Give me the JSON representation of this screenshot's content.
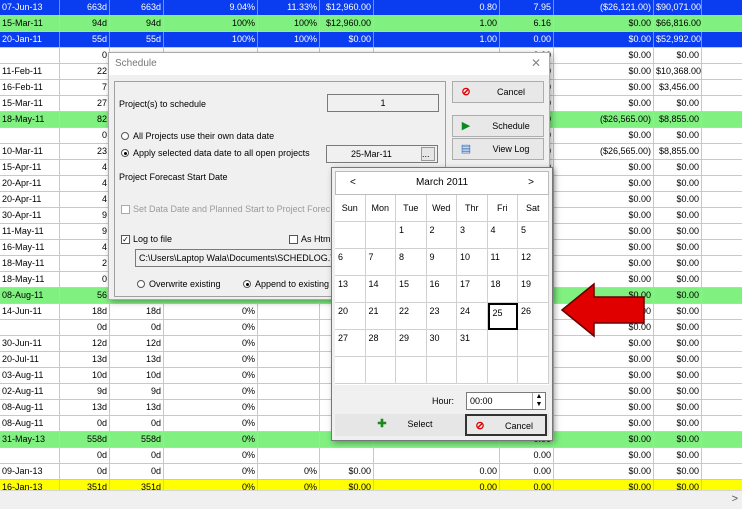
{
  "grid_rows": [
    {
      "style": "blue",
      "c": [
        "07-Jun-13",
        "663d",
        "663d",
        "9.04%",
        "11.33%",
        "$12,960.00",
        "0.80",
        "7.95",
        "($26,121.00)",
        "$90,071.00"
      ]
    },
    {
      "style": "green",
      "c": [
        "15-Mar-11",
        "94d",
        "94d",
        "100%",
        "100%",
        "$12,960.00",
        "1.00",
        "6.16",
        "$0.00",
        "$66,816.00"
      ]
    },
    {
      "style": "blue",
      "c": [
        "20-Jan-11",
        "55d",
        "55d",
        "100%",
        "100%",
        "$0.00",
        "1.00",
        "0.00",
        "$0.00",
        "$52,992.00"
      ]
    },
    {
      "style": "",
      "c": [
        "",
        "0",
        "",
        "",
        "",
        "",
        "",
        "0.00",
        "$0.00",
        "$0.00"
      ]
    },
    {
      "style": "",
      "c": [
        "11-Feb-11",
        "22",
        "",
        "",
        "",
        "",
        "",
        "0.00",
        "$0.00",
        "$10,368.00"
      ]
    },
    {
      "style": "",
      "c": [
        "16-Feb-11",
        "7",
        "",
        "",
        "",
        "",
        "",
        "0.00",
        "$0.00",
        "$3,456.00"
      ]
    },
    {
      "style": "",
      "c": [
        "15-Mar-11",
        "27",
        "",
        "",
        "",
        "",
        "",
        "1.00",
        "$0.00",
        "$0.00"
      ]
    },
    {
      "style": "green",
      "c": [
        "18-May-11",
        "82",
        "",
        "",
        "",
        "",
        "",
        "0.00",
        "($26,565.00)",
        "$8,855.00"
      ]
    },
    {
      "style": "",
      "c": [
        "",
        "0",
        "",
        "",
        "",
        "",
        "",
        "0.00",
        "$0.00",
        "$0.00"
      ]
    },
    {
      "style": "",
      "c": [
        "10-Mar-11",
        "23",
        "",
        "",
        "",
        "",
        "",
        "0.00",
        "($26,565.00)",
        "$8,855.00"
      ]
    },
    {
      "style": "",
      "c": [
        "15-Apr-11",
        "4",
        "",
        "",
        "",
        "",
        "",
        "0.00",
        "$0.00",
        "$0.00"
      ]
    },
    {
      "style": "",
      "c": [
        "20-Apr-11",
        "4",
        "",
        "",
        "",
        "",
        "",
        "0.00",
        "$0.00",
        "$0.00"
      ]
    },
    {
      "style": "",
      "c": [
        "20-Apr-11",
        "4",
        "",
        "",
        "",
        "",
        "",
        "0.00",
        "$0.00",
        "$0.00"
      ]
    },
    {
      "style": "",
      "c": [
        "30-Apr-11",
        "9",
        "",
        "",
        "",
        "",
        "",
        "0.00",
        "$0.00",
        "$0.00"
      ]
    },
    {
      "style": "",
      "c": [
        "11-May-11",
        "9",
        "",
        "",
        "",
        "",
        "",
        "0.00",
        "$0.00",
        "$0.00"
      ]
    },
    {
      "style": "",
      "c": [
        "16-May-11",
        "4",
        "",
        "",
        "",
        "",
        "",
        "0.00",
        "$0.00",
        "$0.00"
      ]
    },
    {
      "style": "",
      "c": [
        "18-May-11",
        "2",
        "",
        "",
        "",
        "",
        "",
        "0.00",
        "$0.00",
        "$0.00"
      ]
    },
    {
      "style": "",
      "c": [
        "18-May-11",
        "0",
        "",
        "",
        "",
        "",
        "",
        "0.00",
        "$0.00",
        "$0.00"
      ]
    },
    {
      "style": "green",
      "c": [
        "08-Aug-11",
        "56",
        "",
        "",
        "",
        "",
        "",
        "0.00",
        "$0.00",
        "$0.00"
      ]
    },
    {
      "style": "",
      "c": [
        "14-Jun-11",
        "18d",
        "18d",
        "0%",
        "",
        "",
        "",
        "0.00",
        "$0.00",
        "$0.00"
      ]
    },
    {
      "style": "",
      "c": [
        "",
        "0d",
        "0d",
        "0%",
        "",
        "",
        "",
        "0.00",
        "$0.00",
        "$0.00"
      ]
    },
    {
      "style": "",
      "c": [
        "30-Jun-11",
        "12d",
        "12d",
        "0%",
        "",
        "",
        "",
        "0.00",
        "$0.00",
        "$0.00"
      ]
    },
    {
      "style": "",
      "c": [
        "20-Jul-11",
        "13d",
        "13d",
        "0%",
        "",
        "",
        "",
        "0.00",
        "$0.00",
        "$0.00"
      ]
    },
    {
      "style": "",
      "c": [
        "03-Aug-11",
        "10d",
        "10d",
        "0%",
        "",
        "",
        "",
        "0.00",
        "$0.00",
        "$0.00"
      ]
    },
    {
      "style": "",
      "c": [
        "02-Aug-11",
        "9d",
        "9d",
        "0%",
        "",
        "",
        "",
        "0.00",
        "$0.00",
        "$0.00"
      ]
    },
    {
      "style": "",
      "c": [
        "08-Aug-11",
        "13d",
        "13d",
        "0%",
        "",
        "",
        "",
        "0.00",
        "$0.00",
        "$0.00"
      ]
    },
    {
      "style": "",
      "c": [
        "08-Aug-11",
        "0d",
        "0d",
        "0%",
        "",
        "",
        "",
        "0.00",
        "$0.00",
        "$0.00"
      ]
    },
    {
      "style": "green",
      "c": [
        "31-May-13",
        "558d",
        "558d",
        "0%",
        "",
        "",
        "",
        "0.00",
        "$0.00",
        "$0.00"
      ]
    },
    {
      "style": "",
      "c": [
        "",
        "0d",
        "0d",
        "0%",
        "",
        "",
        "",
        "0.00",
        "$0.00",
        "$0.00"
      ]
    },
    {
      "style": "",
      "c": [
        "09-Jan-13",
        "0d",
        "0d",
        "0%",
        "0%",
        "$0.00",
        "0.00",
        "0.00",
        "$0.00",
        "$0.00"
      ]
    },
    {
      "style": "yellow",
      "c": [
        "16-Jan-13",
        "351d",
        "351d",
        "0%",
        "0%",
        "$0.00",
        "0.00",
        "0.00",
        "$0.00",
        "$0.00"
      ]
    },
    {
      "style": "",
      "c": [
        "02-Sep-11",
        "3d",
        "3d",
        "0%",
        "0%",
        "$0.00",
        "0.00",
        "0.00",
        "$0.00",
        "$0.00"
      ]
    }
  ],
  "dialog": {
    "title": "Schedule",
    "close": "✕",
    "projects_label": "Project(s) to schedule",
    "projects_value": "1",
    "radio_own": "All Projects use their own data date",
    "radio_apply": "Apply selected data date to all open projects",
    "data_date": "25-Mar-11",
    "browse": "...",
    "forecast_label": "Project Forecast Start Date",
    "set_data_date": "Set Data Date and Planned Start to Project Forec",
    "log_to_file": "Log to file",
    "as_html": "As Html",
    "log_path": "C:\\Users\\Laptop Wala\\Documents\\SCHEDLOG.T",
    "overwrite": "Overwrite existing",
    "append": "Append to existing",
    "btn_cancel": "Cancel",
    "btn_schedule": "Schedule",
    "btn_viewlog": "View Log"
  },
  "calendar": {
    "prev": "<",
    "next": ">",
    "month": "March 2011",
    "days_of_week": [
      "Sun",
      "Mon",
      "Tue",
      "Wed",
      "Thr",
      "Fri",
      "Sat"
    ],
    "days": [
      "1",
      "2",
      "3",
      "4",
      "5",
      "6",
      "7",
      "8",
      "9",
      "10",
      "11",
      "12",
      "13",
      "14",
      "15",
      "16",
      "17",
      "18",
      "19",
      "20",
      "21",
      "22",
      "23",
      "24",
      "25",
      "26",
      "27",
      "28",
      "29",
      "30",
      "31"
    ],
    "first_weekday": 2,
    "selected_day": "25",
    "hour_label": "Hour:",
    "hour_value": "00:00",
    "select": "Select",
    "cancel": "Cancel"
  },
  "scroll_right": ">",
  "colors": {
    "blue_row": "#0a3cf0",
    "green_row": "#80f080",
    "yellow_row": "#ffff00",
    "arrow": "#e00000"
  }
}
